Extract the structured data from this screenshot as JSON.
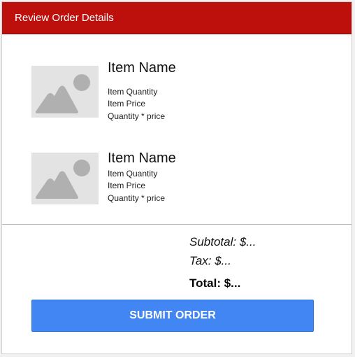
{
  "header": {
    "title": "Review Order Details"
  },
  "items": [
    {
      "image_icon": "image-placeholder-icon",
      "name": "Item Name",
      "quantity": "Item Quantity",
      "price": "Item Price",
      "line_total": "Quantity * price"
    },
    {
      "image_icon": "image-placeholder-icon",
      "name": "Item Name",
      "quantity": "Item Quantity",
      "price": "Item Price",
      "line_total": "Quantity * price"
    }
  ],
  "summary": {
    "subtotal": "Subtotal: $...",
    "tax": "Tax: $...",
    "total": "Total: $..."
  },
  "actions": {
    "submit_label": "SUBMIT ORDER"
  },
  "colors": {
    "header_bg": "#bd0f0b",
    "button_bg": "#4286f4",
    "placeholder_bg": "#e3e3e3",
    "placeholder_icon": "#b0b0b0"
  }
}
